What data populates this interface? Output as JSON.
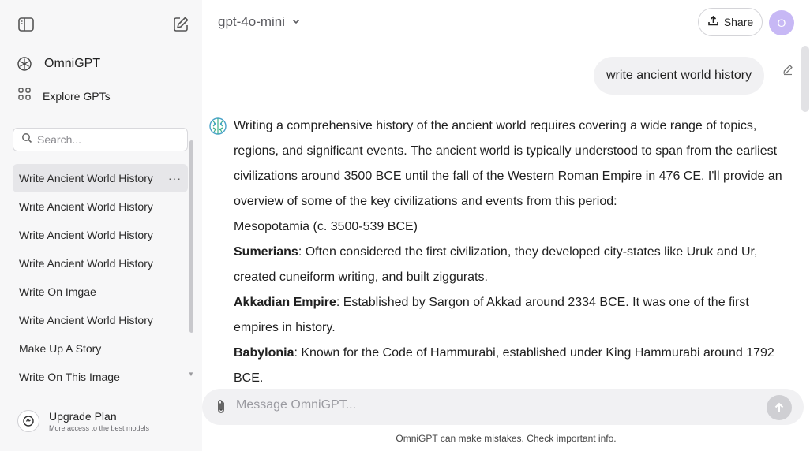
{
  "sidebar": {
    "brand": "OmniGPT",
    "explore": "Explore GPTs",
    "search_placeholder": "Search...",
    "chats": [
      {
        "label": "Write Ancient World History"
      },
      {
        "label": "Write Ancient World History"
      },
      {
        "label": "Write Ancient World History"
      },
      {
        "label": "Write Ancient World History"
      },
      {
        "label": "Write On Imgae"
      },
      {
        "label": "Write Ancient World History"
      },
      {
        "label": "Make Up A Story"
      },
      {
        "label": "Write On This Image"
      }
    ],
    "more_label": "···",
    "upgrade_title": "Upgrade Plan",
    "upgrade_sub": "More access to the best models"
  },
  "header": {
    "model": "gpt-4o-mini",
    "share": "Share",
    "avatar": "O"
  },
  "conversation": {
    "user_message": "write ancient world history",
    "answer": {
      "intro": "Writing a comprehensive history of the ancient world requires covering a wide range of topics, regions, and significant events. The ancient world is typically understood to span from the earliest civilizations around 3500 BCE until the fall of the Western Roman Empire in 476 CE. I'll provide an overview of some of the key civilizations and events from this period:",
      "section": "Mesopotamia (c. 3500-539 BCE)",
      "items": [
        {
          "term": "Sumerians",
          "text": ": Often considered the first civilization, they developed city-states like Uruk and Ur, created cuneiform writing, and built ziggurats."
        },
        {
          "term": "Akkadian Empire",
          "text": ": Established by Sargon of Akkad around 2334 BCE. It was one of the first empires in history."
        },
        {
          "term": "Babylonia",
          "text": ": Known for the Code of Hammurabi, established under King Hammurabi around 1792 BCE."
        }
      ]
    }
  },
  "composer": {
    "placeholder": "Message OmniGPT...",
    "disclaimer": "OmniGPT can make mistakes. Check important info."
  },
  "icons": {
    "sidebar_toggle": "sidebar-toggle-icon",
    "new_chat": "new-chat-icon",
    "logo": "omnigpt-logo-icon",
    "explore": "grid-icon",
    "search": "search-icon",
    "upgrade": "upgrade-icon",
    "chevron": "chevron-down-icon",
    "share": "upload-icon",
    "edit": "pencil-icon",
    "bot": "bot-brain-icon",
    "attach": "paperclip-icon",
    "send": "arrow-up-icon"
  },
  "colors": {
    "sidebar_bg": "#f7f7f8",
    "active_chat_bg": "#e6e6e9",
    "avatar_bg": "#c7b8f5",
    "bubble_bg": "#f1f1f3"
  }
}
